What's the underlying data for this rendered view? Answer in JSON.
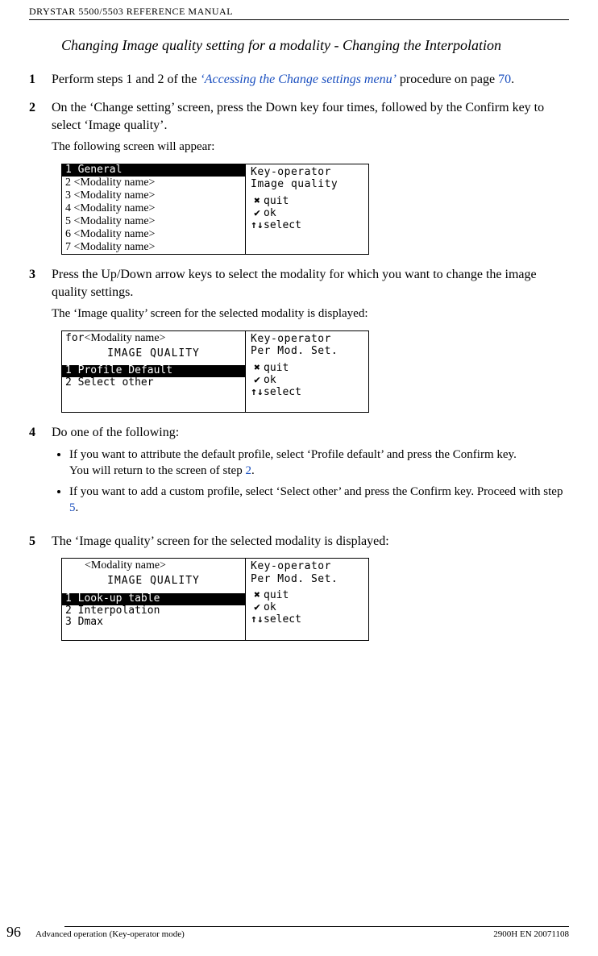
{
  "running_head": "DRYSTAR 5500/5503 REFERENCE MANUAL",
  "section_title": "Changing Image quality setting for a modality - Changing the Interpolation",
  "steps": {
    "s1": {
      "num": "1",
      "pre": "Perform steps 1 and 2 of the ",
      "link": "‘Accessing the Change settings menu’",
      "mid": " procedure on page ",
      "page": "70",
      "post": "."
    },
    "s2": {
      "num": "2",
      "text": "On the ‘Change setting’ screen, press the Down key four times, followed by the Confirm key to select ‘Image quality’.",
      "sub": "The following screen will appear:"
    },
    "s3": {
      "num": "3",
      "text": "Press the Up/Down arrow keys to select the modality for which you want to change the image quality settings.",
      "sub": "The ‘Image quality’ screen for the selected modality is displayed:"
    },
    "s4": {
      "num": "4",
      "text": "Do one of the following:",
      "b1a": "If you want to attribute the default profile, select ‘Profile default’ and press the Confirm key.",
      "b1b": "You will return to the screen of step ",
      "b1ref": "2",
      "b1c": ".",
      "b2a": "If you want to add a custom profile, select ‘Select other’ and press the Confirm key. Proceed with step ",
      "b2ref": "5",
      "b2b": "."
    },
    "s5": {
      "num": "5",
      "text": "The ‘Image quality’ screen for the selected modality is displayed:"
    }
  },
  "lcd1": {
    "rows": [
      "1 General",
      "2 <Modality name>",
      "3 <Modality name>",
      "4 <Modality name>",
      "5 <Modality name>",
      "6 <Modality name>",
      "7 <Modality name>"
    ],
    "hdr1": "Key-operator",
    "hdr2": "Image quality",
    "quit": "quit",
    "ok": "ok",
    "select": "select"
  },
  "lcd2": {
    "for": "for",
    "modname": "<Modality name>",
    "title": "IMAGE QUALITY",
    "rows": [
      "1 Profile Default",
      "2 Select other"
    ],
    "hdr1": "Key-operator",
    "hdr2": "Per Mod. Set.",
    "quit": "quit",
    "ok": "ok",
    "select": "select"
  },
  "lcd3": {
    "modname": "<Modality name>",
    "title": "IMAGE QUALITY",
    "rows": [
      "1 Look-up table",
      "2 Interpolation",
      "3 Dmax"
    ],
    "hdr1": "Key-operator",
    "hdr2": "Per Mod. Set.",
    "quit": "quit",
    "ok": "ok",
    "select": "select"
  },
  "footer": {
    "pagenum": "96",
    "left": "Advanced operation (Key-operator mode)",
    "right": "2900H EN 20071108"
  }
}
